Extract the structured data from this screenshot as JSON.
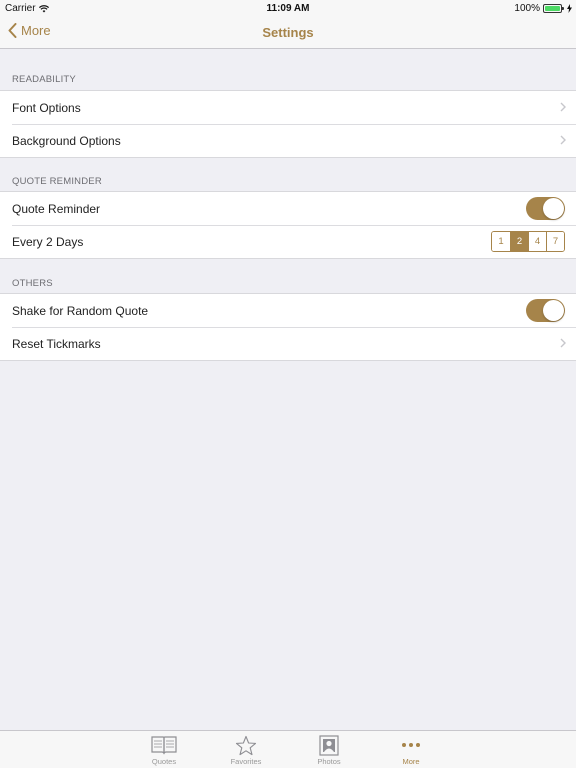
{
  "status_bar": {
    "carrier": "Carrier",
    "time": "11:09 AM",
    "battery": "100%"
  },
  "nav": {
    "back_label": "More",
    "title": "Settings"
  },
  "sections": {
    "readability": {
      "header": "READABILITY",
      "font_options": "Font Options",
      "background_options": "Background Options"
    },
    "quote_reminder": {
      "header": "QUOTE REMINDER",
      "reminder_label": "Quote Reminder",
      "reminder_on": true,
      "interval_label": "Every 2 Days",
      "interval_options": [
        "1",
        "2",
        "4",
        "7"
      ],
      "interval_selected": "2"
    },
    "others": {
      "header": "OTHERS",
      "shake_label": "Shake for Random Quote",
      "shake_on": true,
      "reset_label": "Reset Tickmarks"
    }
  },
  "tab_bar": {
    "tabs": [
      {
        "label": "Quotes",
        "icon": "book-icon"
      },
      {
        "label": "Favorites",
        "icon": "star-icon"
      },
      {
        "label": "Photos",
        "icon": "photo-icon"
      },
      {
        "label": "More",
        "icon": "more-dots-icon"
      }
    ],
    "active": "More"
  },
  "colors": {
    "accent": "#a6844a",
    "background": "#efeff4",
    "battery": "#4cd964"
  }
}
